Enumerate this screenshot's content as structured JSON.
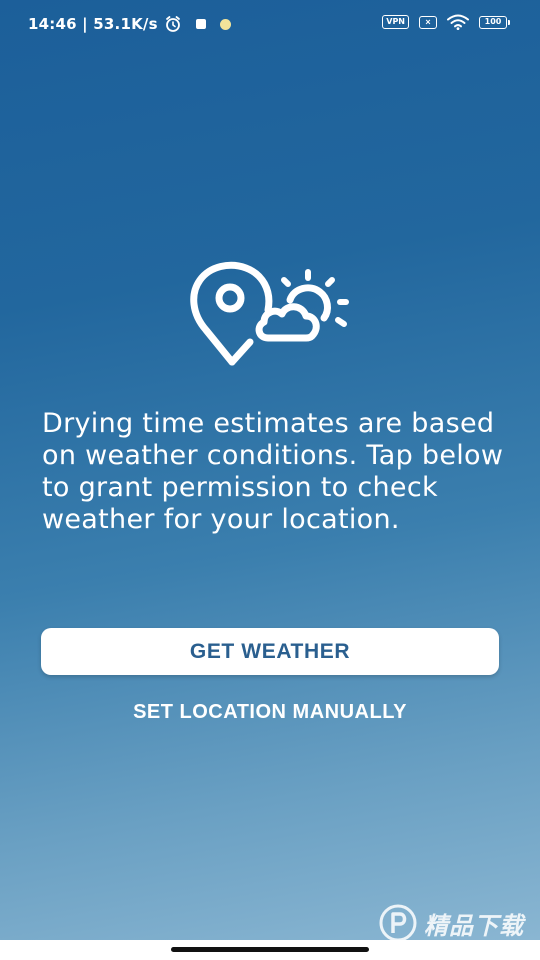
{
  "status_bar": {
    "time_speed": "14:46 | 53.1K/s",
    "alarm_icon": "alarm-clock-icon",
    "vpn_label": "VPN",
    "sim_label": "×",
    "wifi_icon": "wifi-icon",
    "battery_level": "100"
  },
  "hero": {
    "icon": "location-weather-icon"
  },
  "message": {
    "text": "Drying time estimates are based on weather conditions. Tap below to grant permission to check weather for your location."
  },
  "actions": {
    "get_weather_label": "GET WEATHER",
    "set_location_label": "SET LOCATION MANUALLY"
  },
  "watermark": {
    "text": "精品下载"
  },
  "colors": {
    "background_top": "#1c5f9a",
    "background_bottom": "#8ab6d2",
    "button_text": "#2a5f8f",
    "button_bg": "#ffffff"
  }
}
